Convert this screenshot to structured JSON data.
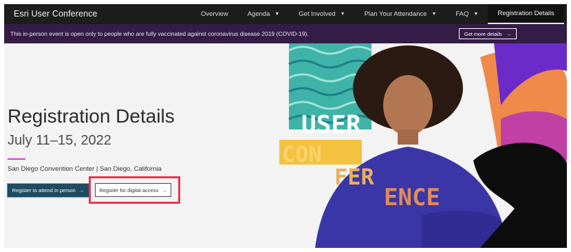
{
  "brand": "Esri User Conference",
  "nav": {
    "items": [
      {
        "label": "Overview",
        "caret": ""
      },
      {
        "label": "Agenda",
        "caret": "▼"
      },
      {
        "label": "Get Involved",
        "caret": "▼"
      },
      {
        "label": "Plan Your Attendance",
        "caret": "▼"
      },
      {
        "label": "FAQ",
        "caret": "▼"
      }
    ],
    "active_label": "Registration Details"
  },
  "notice": {
    "text": "This in-person event is open only to people who are fully vaccinated against coronavirus disease 2019 (COVID-19).",
    "button_label": "Get more details",
    "button_arrow": "→"
  },
  "hero": {
    "title": "Registration Details",
    "dates": "July 11–15, 2022",
    "location": "San Diego Convention Center | San Diego, California",
    "btn_person_label": "Register to attend in person",
    "btn_digital_label": "Register for digital access",
    "arrow": "→",
    "art_text": {
      "line1": "USER",
      "line2": "CON",
      "line3": "FER",
      "line4": "ENCE"
    }
  },
  "colors": {
    "nav_bg": "#1d1d1d",
    "notice_bg": "#351c47",
    "accent_magenta": "#d23bd0",
    "btn_primary": "#1f4b62",
    "highlight_red": "#e6374f"
  }
}
